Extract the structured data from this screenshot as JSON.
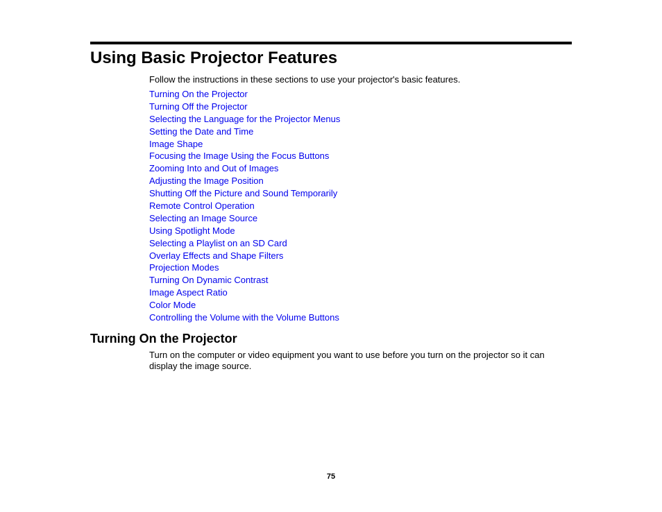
{
  "page": {
    "title": "Using Basic Projector Features",
    "intro": "Follow the instructions in these sections to use your projector's basic features.",
    "links": [
      "Turning On the Projector",
      "Turning Off the Projector",
      "Selecting the Language for the Projector Menus",
      "Setting the Date and Time",
      "Image Shape",
      "Focusing the Image Using the Focus Buttons",
      "Zooming Into and Out of Images",
      "Adjusting the Image Position",
      "Shutting Off the Picture and Sound Temporarily",
      "Remote Control Operation",
      "Selecting an Image Source",
      "Using Spotlight Mode",
      "Selecting a Playlist on an SD Card",
      "Overlay Effects and Shape Filters",
      "Projection Modes",
      "Turning On Dynamic Contrast",
      "Image Aspect Ratio",
      "Color Mode",
      "Controlling the Volume with the Volume Buttons"
    ],
    "section": {
      "title": "Turning On the Projector",
      "body": "Turn on the computer or video equipment you want to use before you turn on the projector so it can display the image source."
    },
    "page_number": "75"
  },
  "colors": {
    "link": "#0000ee",
    "text": "#000000"
  }
}
